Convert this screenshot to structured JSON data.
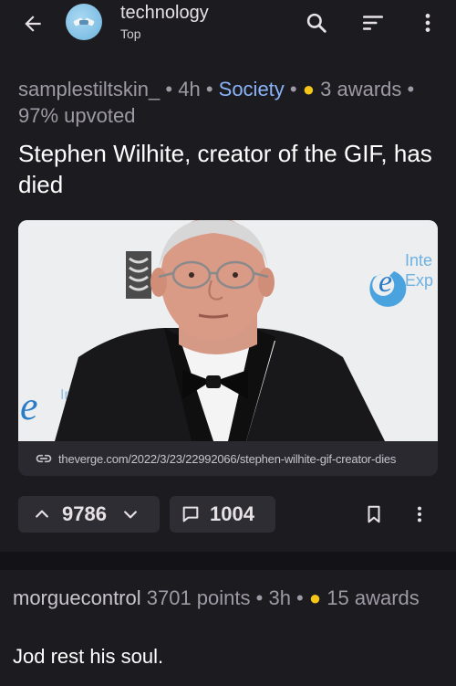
{
  "header": {
    "subreddit": "technology",
    "sort": "Top",
    "icons": [
      "back-arrow-icon",
      "search-icon",
      "sort-icon",
      "more-vertical-icon"
    ]
  },
  "post": {
    "author": "samplestiltskin_",
    "sep1": " • ",
    "age": "4h",
    "sep2": " • ",
    "flair": "Society",
    "sep3": " • ",
    "award_dot": "●",
    "awards": " 3 awards",
    "sep4": " • ",
    "upvoted": "97% upvoted",
    "title": "Stephen Wilhite, creator of the GIF, has died",
    "image_signage_1": "Inte",
    "image_signage_2": "Exp",
    "image_signage_3": "Int",
    "link": "theverge.com/2022/3/23/22992066/stephen-wilhite-gif-creator-dies",
    "votes": "9786",
    "comments": "1004"
  },
  "comment": {
    "author": "morguecontrol",
    "points": " 3701 points",
    "sep1": " • ",
    "age": "3h",
    "sep2": " • ",
    "award_dot": "●",
    "awards": " 15 awards",
    "body": "Jod rest his soul."
  },
  "colors": {
    "background": "#1c1b1f",
    "flair": "#8ab4f8",
    "award": "#f5c518",
    "pill": "#2e2d33"
  }
}
